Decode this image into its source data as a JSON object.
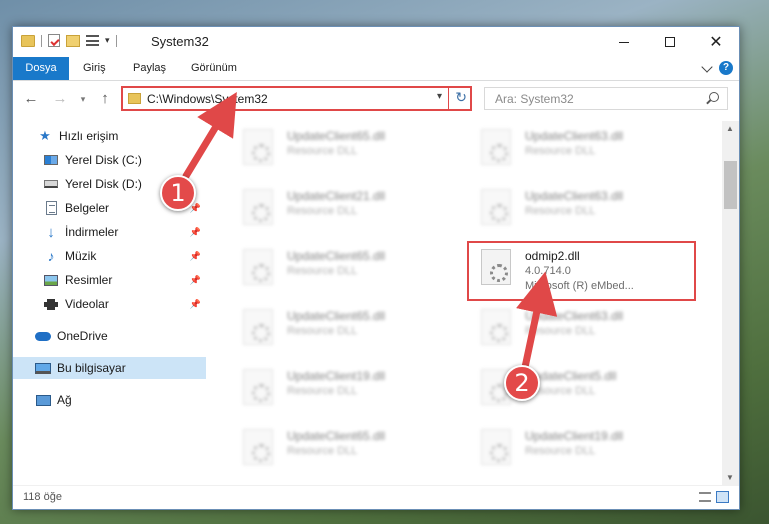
{
  "window": {
    "title": "System32"
  },
  "ribbon": {
    "tabs": [
      "Dosya",
      "Giriş",
      "Paylaş",
      "Görünüm"
    ],
    "help_label": "?"
  },
  "nav": {
    "back_icon": "back-arrow-icon",
    "forward_icon": "forward-arrow-icon",
    "up_icon": "up-arrow-icon"
  },
  "address": {
    "path": "C:\\Windows\\System32"
  },
  "search": {
    "placeholder": "Ara: System32"
  },
  "sidebar": {
    "items": [
      {
        "label": "Hızlı erişim",
        "icon": "star-icon",
        "pinned": false
      },
      {
        "label": "Yerel Disk (C:)",
        "icon": "drive-icon",
        "pinned": false
      },
      {
        "label": "Yerel Disk (D:)",
        "icon": "drive-icon",
        "pinned": false
      },
      {
        "label": "Belgeler",
        "icon": "documents-icon",
        "pinned": true
      },
      {
        "label": "İndirmeler",
        "icon": "downloads-icon",
        "pinned": true
      },
      {
        "label": "Müzik",
        "icon": "music-icon",
        "pinned": true
      },
      {
        "label": "Resimler",
        "icon": "pictures-icon",
        "pinned": true
      },
      {
        "label": "Videolar",
        "icon": "videos-icon",
        "pinned": true
      },
      {
        "label": "OneDrive",
        "icon": "onedrive-icon",
        "pinned": false
      },
      {
        "label": "Bu bilgisayar",
        "icon": "this-pc-icon",
        "pinned": false,
        "selected": true
      },
      {
        "label": "Ağ",
        "icon": "network-icon",
        "pinned": false
      }
    ]
  },
  "files": {
    "left": [
      {
        "name": "UpdateClient65.dll",
        "desc": "Resource DLL"
      },
      {
        "name": "UpdateClient21.dll",
        "desc": "Resource DLL"
      },
      {
        "name": "UpdateClient65.dll",
        "desc": "Resource DLL"
      },
      {
        "name": "UpdateClient65.dll",
        "desc": "Resource DLL"
      },
      {
        "name": "UpdateClient19.dll",
        "desc": "Resource DLL"
      },
      {
        "name": "UpdateClient65.dll",
        "desc": "Resource DLL"
      }
    ],
    "right": [
      {
        "name": "UpdateClient63.dll",
        "desc": "Resource DLL"
      },
      {
        "name": "UpdateClient63.dll",
        "desc": "Resource DLL"
      },
      {
        "name": "odmip2.dll",
        "version": "4.0.714.0",
        "desc": "Microsoft (R) eMbed...",
        "highlighted": true
      },
      {
        "name": "UpdateClient63.dll",
        "desc": "Resource DLL"
      },
      {
        "name": "UpdateClient5.dll",
        "desc": "Resource DLL"
      },
      {
        "name": "UpdateClient19.dll",
        "desc": "Resource DLL"
      }
    ]
  },
  "status": {
    "count": "118 öğe"
  },
  "annotations": {
    "step1": "1",
    "step2": "2",
    "color": "#e04848"
  }
}
